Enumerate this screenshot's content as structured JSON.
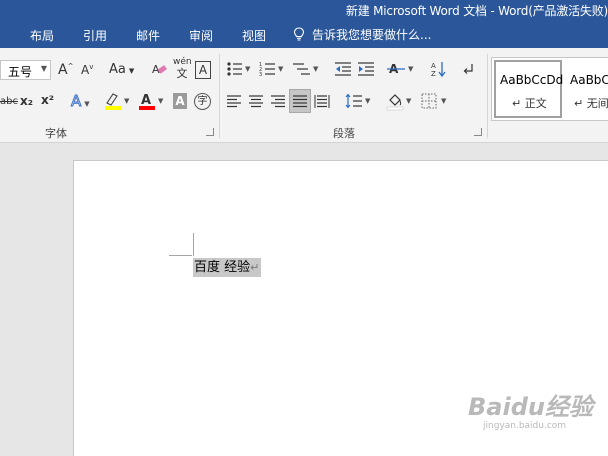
{
  "window": {
    "title": "新建 Microsoft Word 文档 - Word(产品激活失败)"
  },
  "tabs": [
    "布局",
    "引用",
    "邮件",
    "审阅",
    "视图"
  ],
  "tell_me": {
    "placeholder": "告诉我您想要做什么..."
  },
  "font_group": {
    "label": "字体",
    "font_size": "五号",
    "grow_font": "A",
    "shrink_font": "A",
    "change_case": "Aa",
    "phonetic_top": "wén",
    "phonetic_bottom": "文",
    "char_border": "A",
    "strikethrough": "abc",
    "subscript": "x₂",
    "superscript": "x²",
    "text_effects": "A",
    "font_color": "A",
    "char_shading": "A",
    "enclose": "字",
    "highlight_color": "#ffff00",
    "font_color_value": "#ff0000"
  },
  "paragraph_group": {
    "label": "段落"
  },
  "styles_group": {
    "styles": [
      {
        "sample": "AaBbCcDd",
        "name": "↵ 正文"
      },
      {
        "sample": "AaBbC",
        "name": "↵ 无间"
      }
    ]
  },
  "document": {
    "text": "百度 经验",
    "pilcrow": "↵"
  },
  "watermark": {
    "logo": "Baidu经验",
    "url": "jingyan.baidu.com"
  },
  "colors": {
    "accent": "#2b579a",
    "ribbon": "#f3f3f3",
    "selection": "#c8c8c8"
  }
}
